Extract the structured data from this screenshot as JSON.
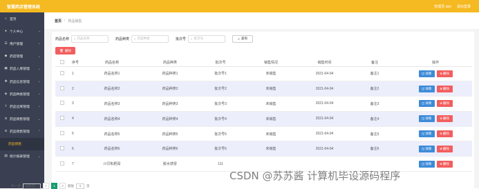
{
  "header": {
    "title": "智慧药店管理系统",
    "user": "管理员 abo",
    "logout": "退出登录"
  },
  "sidebar": {
    "items": [
      {
        "label": "首页",
        "icon": "home-icon"
      },
      {
        "label": "个人中心",
        "icon": "user-icon"
      },
      {
        "label": "用户管理",
        "icon": "users-icon"
      },
      {
        "label": "药店管理",
        "icon": "shop-icon"
      },
      {
        "label": "药品入库管理",
        "icon": "box-icon"
      },
      {
        "label": "药品信息管理",
        "icon": "pill-icon"
      },
      {
        "label": "药品种类管理",
        "icon": "tag-icon"
      },
      {
        "label": "药品出库管理",
        "icon": "export-icon"
      },
      {
        "label": "药品销售管理",
        "icon": "cart-icon"
      },
      {
        "label": "药品销售管理",
        "icon": "cart-icon"
      }
    ],
    "active_sub": "药品销售",
    "last": {
      "label": "统计报表管理",
      "icon": "chart-icon"
    }
  },
  "breadcrumb": {
    "home": "首页",
    "sep": "/",
    "current": "药品销售"
  },
  "filters": {
    "name_label": "药品名称",
    "name_placeholder": "药品名称",
    "type_label": "药品种类",
    "type_placeholder": "药品种类",
    "batch_label": "批次号",
    "batch_placeholder": "批次号",
    "query": "查询"
  },
  "delete_all": "删除",
  "table": {
    "headers": [
      "",
      "序号",
      "药品名称",
      "药品种类",
      "批次号",
      "销售情况",
      "销售时间",
      "备注",
      "操作"
    ],
    "rows": [
      {
        "no": "1",
        "name": "药品名称1",
        "type": "药品种类1",
        "batch": "批次号1",
        "status": "未销售",
        "time": "2021-04-04",
        "note": "备注1"
      },
      {
        "no": "2",
        "name": "药品名称2",
        "type": "药品种类2",
        "batch": "批次号2",
        "status": "未销售",
        "time": "2021-04-04",
        "note": "备注2"
      },
      {
        "no": "3",
        "name": "药品名称3",
        "type": "药品种类3",
        "batch": "批次号3",
        "status": "未销售",
        "time": "2021-04-04",
        "note": "备注3"
      },
      {
        "no": "4",
        "name": "药品名称4",
        "type": "药品种类4",
        "batch": "批次号4",
        "status": "未销售",
        "time": "2021-04-04",
        "note": "备注4"
      },
      {
        "no": "5",
        "name": "药品名称5",
        "type": "药品种类5",
        "batch": "批次号5",
        "status": "未销售",
        "time": "2021-04-04",
        "note": "备注5"
      },
      {
        "no": "6",
        "name": "药品名称6",
        "type": "药品种类6",
        "batch": "批次号6",
        "status": "未销售",
        "time": "2021-04-04",
        "note": "备注6"
      },
      {
        "no": "7",
        "name": "川贝枇杷膏",
        "type": "胶水感冒",
        "batch": "111",
        "status": "",
        "time": "",
        "note": ""
      }
    ],
    "detail_label": "详情",
    "delete_label": "删除"
  },
  "pagination": {
    "total": "共 7 条",
    "page_size": "10条/页",
    "prev": "<",
    "page": "1",
    "next": ">",
    "goto": "前往",
    "goto_value": "1",
    "page_unit": "页"
  },
  "watermark": "CSDN @苏苏酱   计算机毕设源码程序",
  "colors": {
    "accent": "#f5b921",
    "sidebar": "#3a4052",
    "detail": "#3e8bd8",
    "danger": "#f25e5e",
    "row_alt": "#eceefc"
  }
}
